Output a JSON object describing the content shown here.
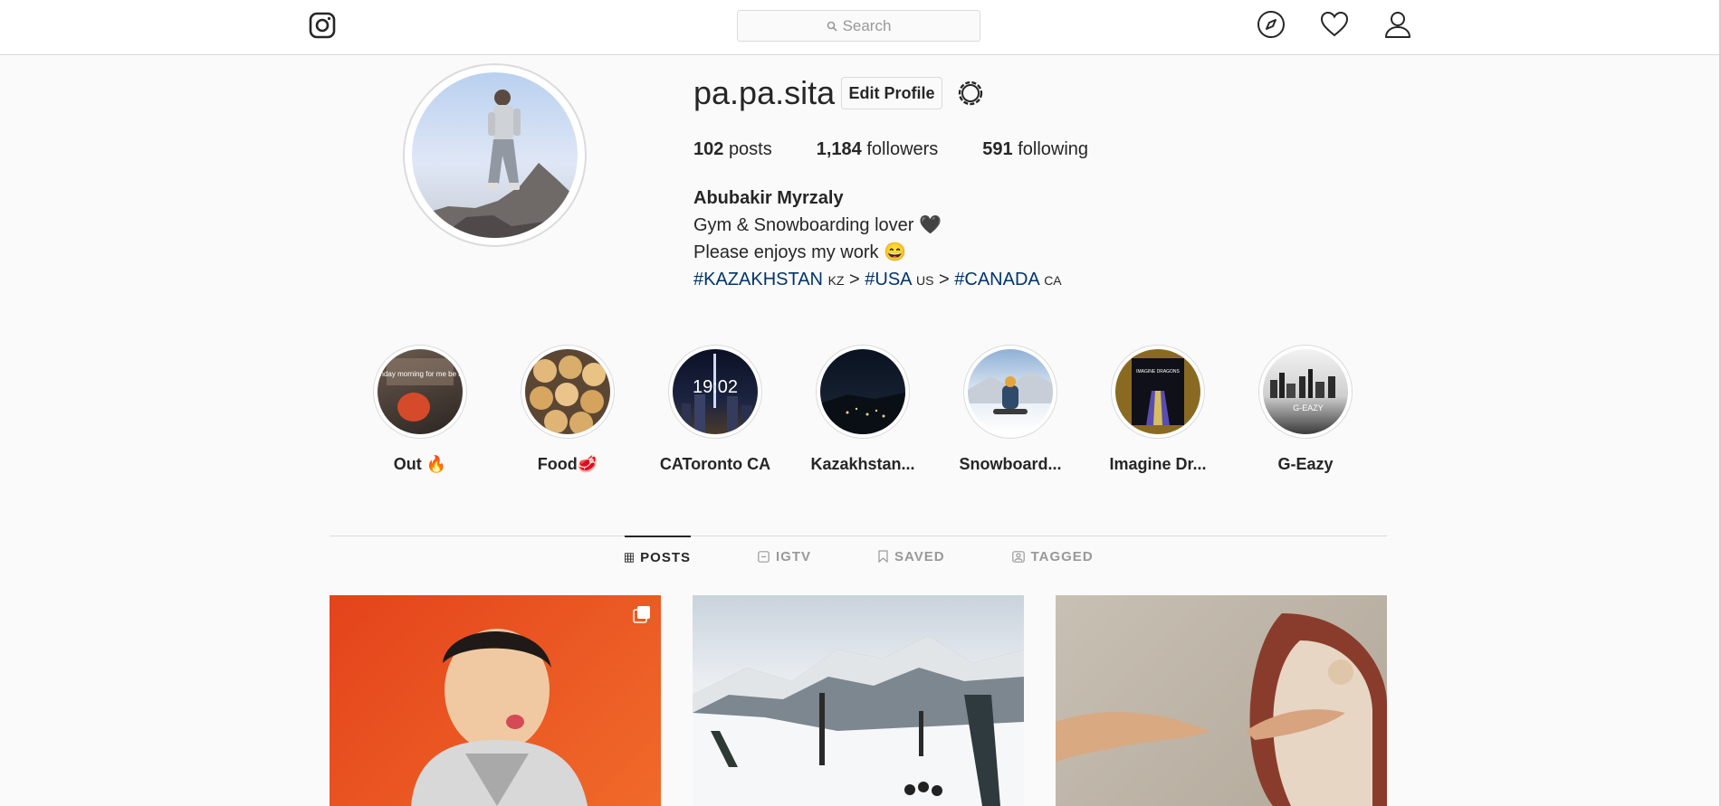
{
  "header": {
    "search_placeholder": "Search",
    "icons": [
      "instagram-logo-icon",
      "search-icon",
      "compass-icon",
      "heart-icon",
      "person-icon"
    ]
  },
  "profile": {
    "username": "pa.pa.sita",
    "edit_label": "Edit Profile",
    "posts_count": "102",
    "posts_label": "posts",
    "followers_count": "1,184",
    "followers_label": "followers",
    "following_count": "591",
    "following_label": "following",
    "full_name": "Abubakir Myrzaly",
    "bio_line1": "Gym & Snowboarding lover 🖤",
    "bio_line2": "Please enjoys my work 😄",
    "hashtags": {
      "tag1": "#KAZAKHSTAN",
      "flag1": "KZ",
      "sep1": ">",
      "tag2": "#USA",
      "flag2": "US",
      "sep2": ">",
      "tag3": "#CANADA",
      "flag3": "CA"
    }
  },
  "highlights": [
    {
      "label": "Out 🔥"
    },
    {
      "label": "Food🥩"
    },
    {
      "label": "CAToronto CA"
    },
    {
      "label": "Kazakhstan..."
    },
    {
      "label": "Snowboard..."
    },
    {
      "label": "Imagine Dr..."
    },
    {
      "label": "G-Eazy"
    }
  ],
  "highlight_texts": {
    "out": "Sunday morning for me be like",
    "toronto_time": "19:02",
    "imagine": "IMAGINE DRAGONS",
    "geazy": "G-EAZY"
  },
  "tabs": [
    {
      "label": "POSTS",
      "icon": "grid-icon",
      "active": true
    },
    {
      "label": "IGTV",
      "icon": "tv-icon",
      "active": false
    },
    {
      "label": "SAVED",
      "icon": "bookmark-icon",
      "active": false
    },
    {
      "label": "TAGGED",
      "icon": "tagged-icon",
      "active": false
    }
  ],
  "colors": {
    "link": "#003569",
    "border": "#dbdbdb",
    "text": "#262626",
    "muted": "#999999"
  }
}
